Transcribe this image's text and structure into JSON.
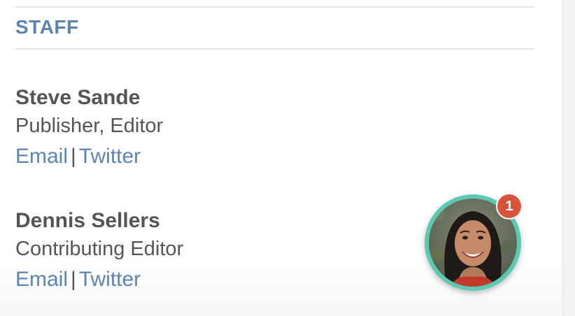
{
  "staff_section": {
    "title": "STAFF",
    "people": [
      {
        "name": "Steve Sande",
        "role": "Publisher, Editor",
        "email_label": "Email",
        "separator": "|",
        "twitter_label": "Twitter"
      },
      {
        "name": "Dennis Sellers",
        "role": "Contributing Editor",
        "email_label": "Email",
        "separator": "|",
        "twitter_label": "Twitter"
      }
    ]
  },
  "chat_widget": {
    "unread_count": "1",
    "accent_color": "#5cc9b2",
    "badge_color": "#d9533c"
  },
  "colors": {
    "link": "#5b84b1",
    "text": "#555555",
    "divider": "#e6e6e6"
  }
}
